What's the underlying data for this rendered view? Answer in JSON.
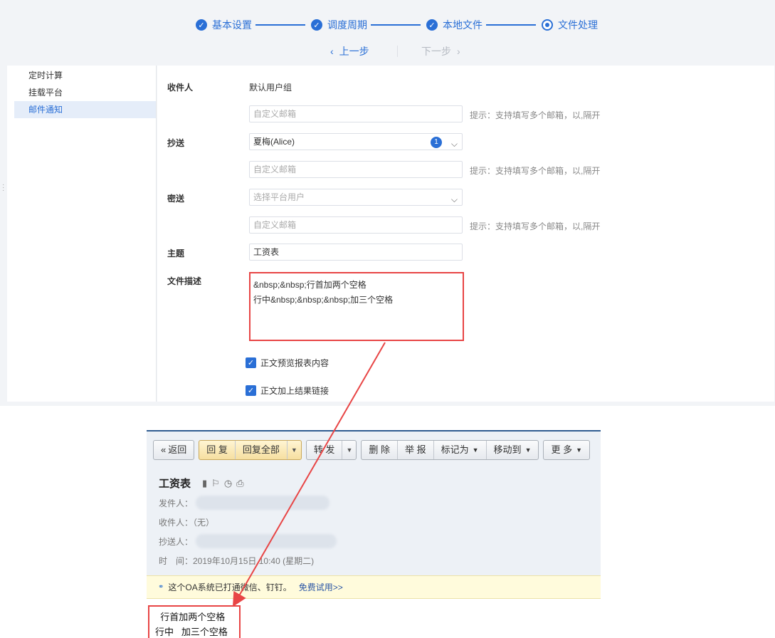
{
  "steps": [
    "基本设置",
    "调度周期",
    "本地文件",
    "文件处理"
  ],
  "nav": {
    "prev": "上一步",
    "next": "下一步"
  },
  "sidebar": {
    "items": [
      "定时计算",
      "挂载平台",
      "邮件通知"
    ]
  },
  "form": {
    "recipient_label": "收件人",
    "recipient_value": "默认用户组",
    "custom_email_placeholder": "自定义邮箱",
    "hint": "提示：支持填写多个邮箱，以,隔开",
    "cc_label": "抄送",
    "cc_value": "夏梅(Alice)",
    "cc_count": "1",
    "bcc_label": "密送",
    "bcc_placeholder": "选择平台用户",
    "subject_label": "主题",
    "subject_value": "工资表",
    "desc_label": "文件描述",
    "desc_lines": [
      "&nbsp;&nbsp;行首加两个空格",
      "行中&nbsp;&nbsp;&nbsp;加三个空格"
    ],
    "check_preview": "正文预览报表内容",
    "check_link": "正文加上结果链接"
  },
  "mail": {
    "toolbar": {
      "back": "返回",
      "reply": "回 复",
      "reply_all": "回复全部",
      "forward": "转 发",
      "delete": "删 除",
      "report": "举 报",
      "mark_as": "标记为",
      "move_to": "移动到",
      "more": "更 多"
    },
    "subject": "工资表",
    "from_label": "发件人：",
    "to_label": "收件人：（无）",
    "cc_label": "抄送人：",
    "time": "时　间：2019年10月15日 10:40 (星期二)",
    "notice": "这个OA系统已打通微信、钉钉。",
    "notice_link": "免费试用>>",
    "body_lines": [
      "  行首加两个空格",
      "行中   加三个空格"
    ]
  },
  "colors": {
    "accent": "#2a6fd6",
    "highlight": "#e84545"
  }
}
